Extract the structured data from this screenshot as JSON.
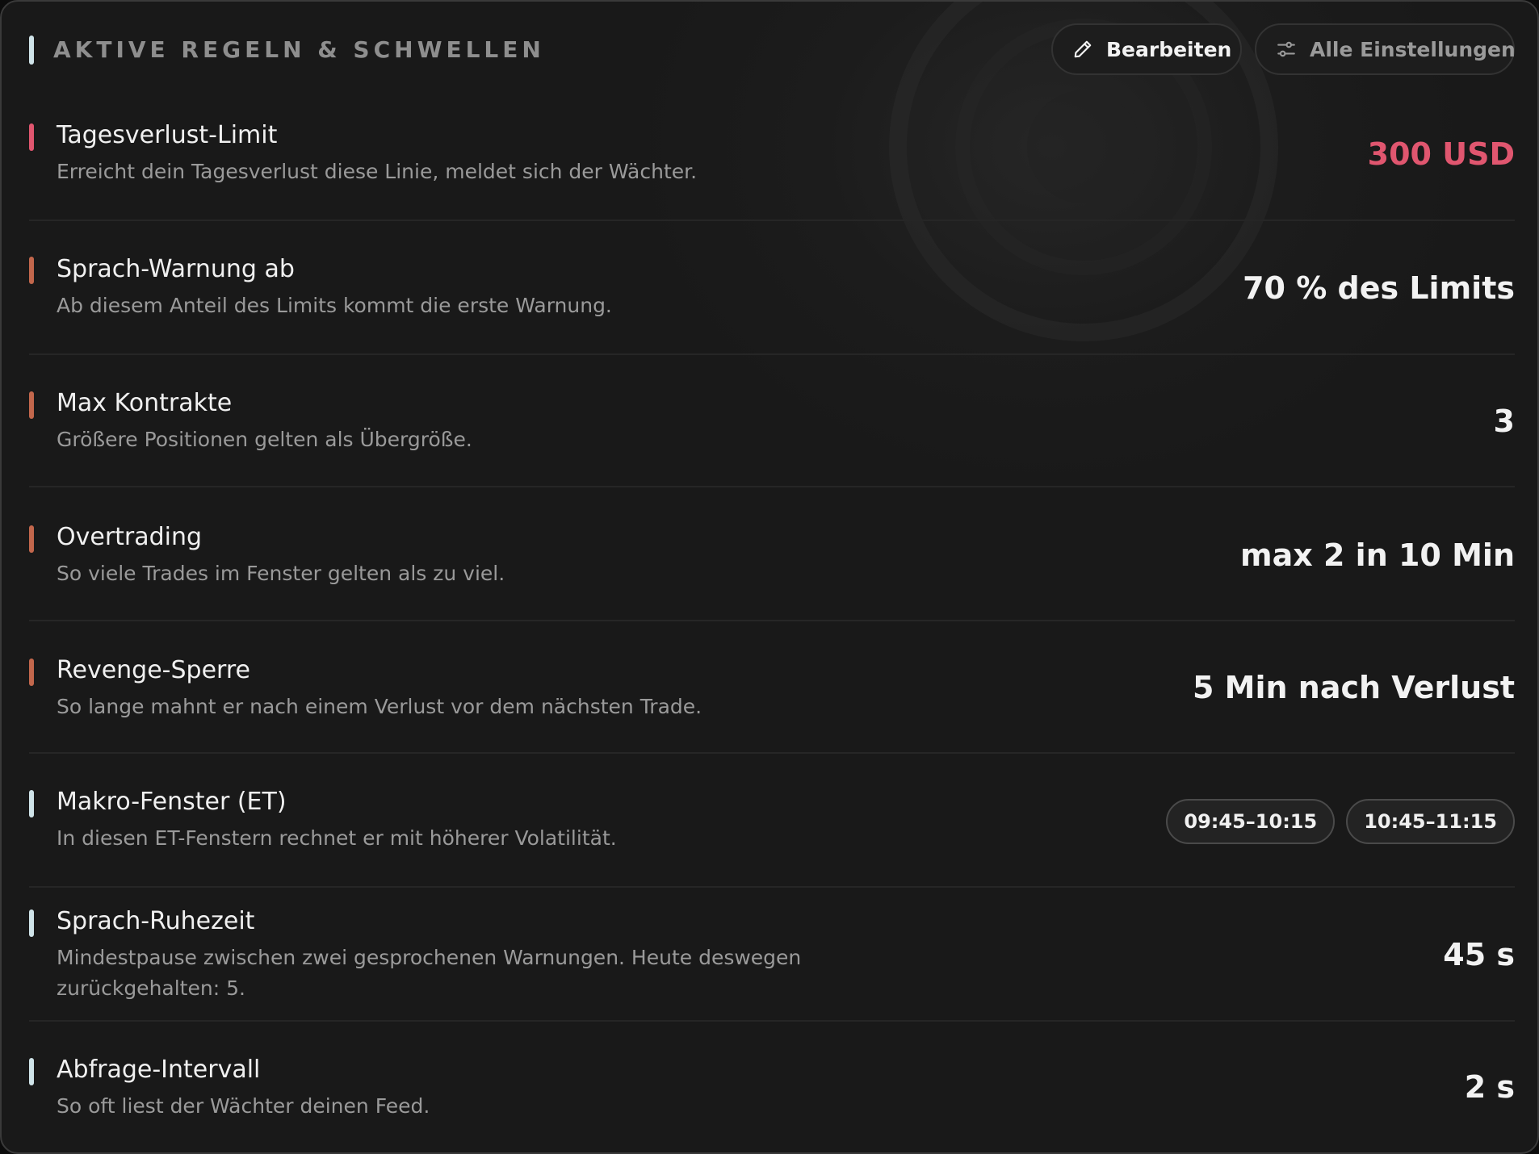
{
  "panel": {
    "title": "AKTIVE REGELN & SCHWELLEN",
    "edit_button_label": "Bearbeiten",
    "settings_button_label": "Alle Einstellungen",
    "edit_icon": "pencil-icon",
    "settings_icon": "sliders-icon"
  },
  "colors": {
    "accent_danger": "#e0566f",
    "accent_warning": "#c2674c",
    "accent_neutral": "#cfe3e8",
    "value_danger_text": "#e0566f"
  },
  "rules": [
    {
      "title": "Tagesverlust-Limit",
      "description": "Erreicht dein Tagesverlust diese Linie, meldet sich der Wächter.",
      "value": "300 USD",
      "severity": "danger"
    },
    {
      "title": "Sprach-Warnung ab",
      "description": "Ab diesem Anteil des Limits kommt die erste Warnung.",
      "value": "70 % des Limits",
      "severity": "warning"
    },
    {
      "title": "Max Kontrakte",
      "description": "Größere Positionen gelten als Übergröße.",
      "value": "3",
      "severity": "warning"
    },
    {
      "title": "Overtrading",
      "description": "So viele Trades im Fenster gelten als zu viel.",
      "value": "max 2 in 10 Min",
      "severity": "warning"
    },
    {
      "title": "Revenge-Sperre",
      "description": "So lange mahnt er nach einem Verlust vor dem nächsten Trade.",
      "value": "5 Min nach Verlust",
      "severity": "warning"
    },
    {
      "title": "Makro-Fenster (ET)",
      "description": "In diesen ET-Fenstern rechnet er mit höherer Volatilität.",
      "chips": [
        "09:45–10:15",
        "10:45–11:15"
      ],
      "severity": "neutral"
    },
    {
      "title": "Sprach-Ruhezeit",
      "description": "Mindestpause zwischen zwei gesprochenen Warnungen. Heute deswegen zurückgehalten: 5.",
      "value": "45 s",
      "severity": "neutral"
    },
    {
      "title": "Abfrage-Intervall",
      "description": "So oft liest der Wächter deinen Feed.",
      "value": "2 s",
      "severity": "neutral"
    }
  ]
}
